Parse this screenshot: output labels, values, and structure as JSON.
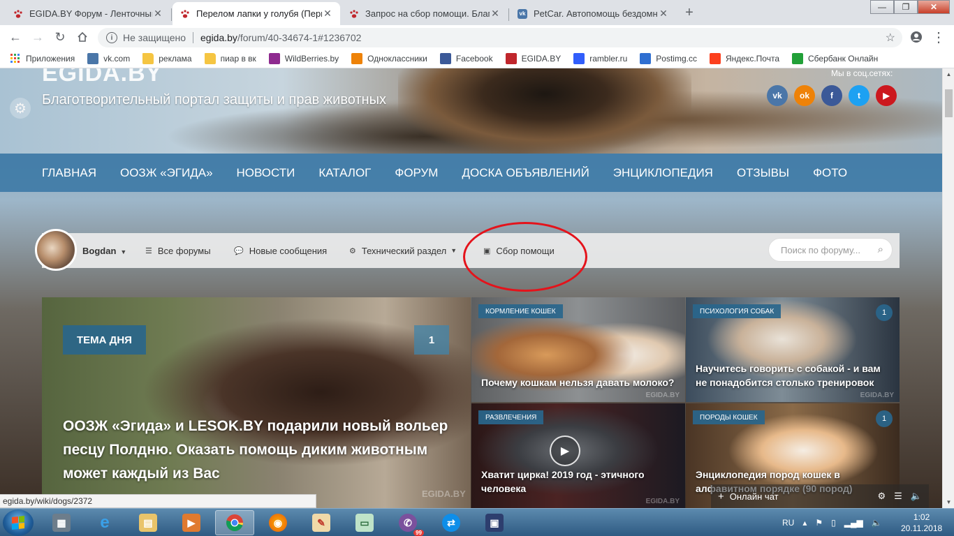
{
  "browser": {
    "tabs": [
      {
        "title": "EGIDA.BY Форум - Ленточный в",
        "favicon": "paw-icon",
        "active": false
      },
      {
        "title": "Перелом лапки у голубя (Перна",
        "favicon": "paw-icon",
        "active": true
      },
      {
        "title": "Запрос на сбор помощи. Благо",
        "favicon": "paw-icon",
        "active": false
      },
      {
        "title": "PetCar. Автопомощь бездомны",
        "favicon": "vk-icon",
        "active": false
      }
    ],
    "address": {
      "security_label": "Не защищено",
      "host": "egida.by",
      "path": "/forum/40-34674-1#1236702"
    },
    "bookmarks": [
      {
        "label": "Приложения",
        "icon": "apps-grid-icon",
        "color": "#e8453c"
      },
      {
        "label": "vk.com",
        "icon": "vk-icon",
        "color": "#4a76a8"
      },
      {
        "label": "реклама",
        "icon": "folder-icon",
        "color": "#f5c542"
      },
      {
        "label": "пиар в вк",
        "icon": "folder-icon",
        "color": "#f5c542"
      },
      {
        "label": "WildBerries.by",
        "icon": "wildberries-icon",
        "color": "#8e2a8f"
      },
      {
        "label": "Одноклассники",
        "icon": "ok-icon",
        "color": "#ee8208"
      },
      {
        "label": "Facebook",
        "icon": "facebook-icon",
        "color": "#3b5998"
      },
      {
        "label": "EGIDA.BY",
        "icon": "paw-icon",
        "color": "#c0262c"
      },
      {
        "label": "rambler.ru",
        "icon": "mail-icon",
        "color": "#315efb"
      },
      {
        "label": "Postimg.cc",
        "icon": "postimg-icon",
        "color": "#2f6fd1"
      },
      {
        "label": "Яндекс.Почта",
        "icon": "yandex-mail-icon",
        "color": "#fc3f1d"
      },
      {
        "label": "Сбербанк Онлайн",
        "icon": "sberbank-icon",
        "color": "#21a038"
      }
    ]
  },
  "site": {
    "logo": "EGIDA.BY",
    "tagline": "Благотворительный портал защиты и прав животных",
    "social_caption": "Мы в соц.сетях:",
    "socials": [
      {
        "name": "vk-icon",
        "glyph": "vk",
        "color": "#4a76a8"
      },
      {
        "name": "ok-icon",
        "glyph": "ok",
        "color": "#ee8208"
      },
      {
        "name": "facebook-icon",
        "glyph": "f",
        "color": "#3b5998"
      },
      {
        "name": "twitter-icon",
        "glyph": "t",
        "color": "#1da1f2"
      },
      {
        "name": "youtube-icon",
        "glyph": "▶",
        "color": "#cc181e"
      }
    ],
    "nav": [
      "ГЛАВНАЯ",
      "ООЗЖ «ЭГИДА»",
      "НОВОСТИ",
      "КАТАЛОГ",
      "ФОРУМ",
      "ДОСКА ОБЪЯВЛЕНИЙ",
      "ЭНЦИКЛОПЕДИЯ",
      "ОТЗЫВЫ",
      "ФОТО"
    ]
  },
  "forumbar": {
    "user": "Bogdan",
    "all_forums": "Все форумы",
    "new_messages": "Новые сообщения",
    "tech_section": "Технический раздел",
    "help_collection": "Сбор помощи",
    "search_placeholder": "Поиск по форуму..."
  },
  "featured": {
    "badge": "ТЕМА ДНЯ",
    "count": "1",
    "title": "ООЗЖ «Эгида» и LESOK.BY подарили новый вольер песцу Полдню. Оказать помощь диким животным может каждый из Вас",
    "watermark": "EGIDA.BY"
  },
  "cards": [
    {
      "tag": "КОРМЛЕНИЕ КОШЕК",
      "count": "",
      "title": "Почему кошкам нельзя давать молоко?"
    },
    {
      "tag": "ПСИХОЛОГИЯ СОБАК",
      "count": "1",
      "title": "Научитесь говорить с собакой - и вам не понадобится столько тренировок"
    },
    {
      "tag": "РАЗВЛЕЧЕНИЯ",
      "count": "",
      "title": "Хватит цирка! 2019 год - этичного человека"
    },
    {
      "tag": "ПОРОДЫ КОШЕК",
      "count": "1",
      "title": "Энциклопедия пород кошек в алфавитном порядке (90 пород)"
    }
  ],
  "card_watermark": "EGIDA.BY",
  "status_url": "egida.by/wiki/dogs/2372",
  "chat": {
    "label": "Онлайн чат"
  },
  "taskbar": {
    "lang": "RU",
    "time": "1:02",
    "date": "20.11.2018",
    "viber_badge": "99"
  }
}
